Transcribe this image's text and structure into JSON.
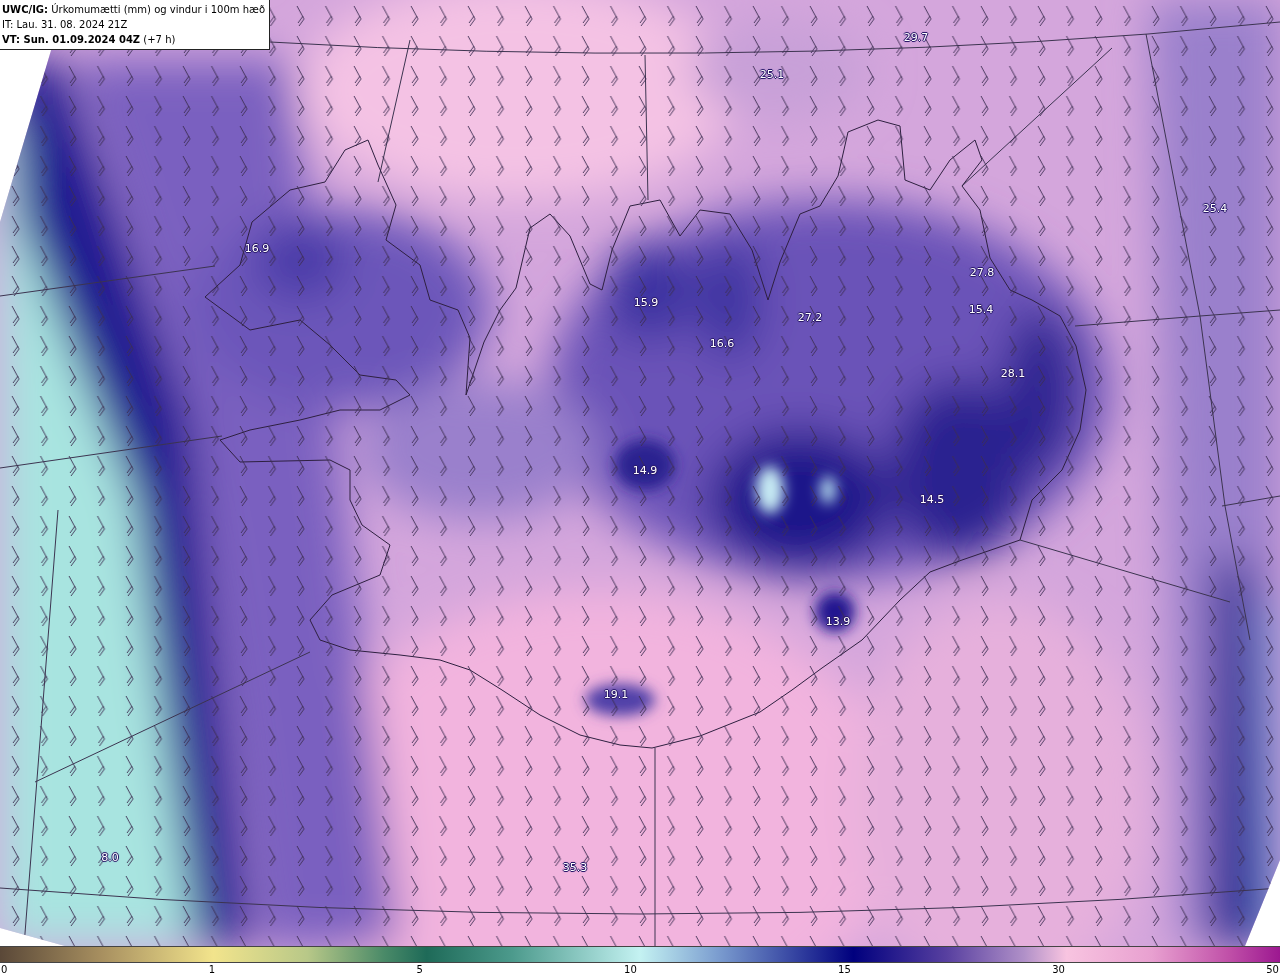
{
  "header": {
    "title": "**UWC/IG:** Úrkomumætti (mm) og vindur i 100m hæð",
    "initial_time": "IT: Lau. 31. 08. 2024 21Z",
    "valid_time": "**VT: Sun. 01.09.2024 04Z** (+7 h)"
  },
  "map": {
    "value_labels": [
      "29.7",
      "25.1",
      "25.4",
      "16.9",
      "27.8",
      "15.9",
      "15.4",
      "27.2",
      "16.6",
      "28.1",
      "14.9",
      "14.5",
      "13.9",
      "19.1",
      "8.0",
      "35.3"
    ]
  },
  "colorbar": {
    "ticks": [
      "0",
      "1",
      "5",
      "10",
      "15",
      "30",
      "50"
    ]
  }
}
